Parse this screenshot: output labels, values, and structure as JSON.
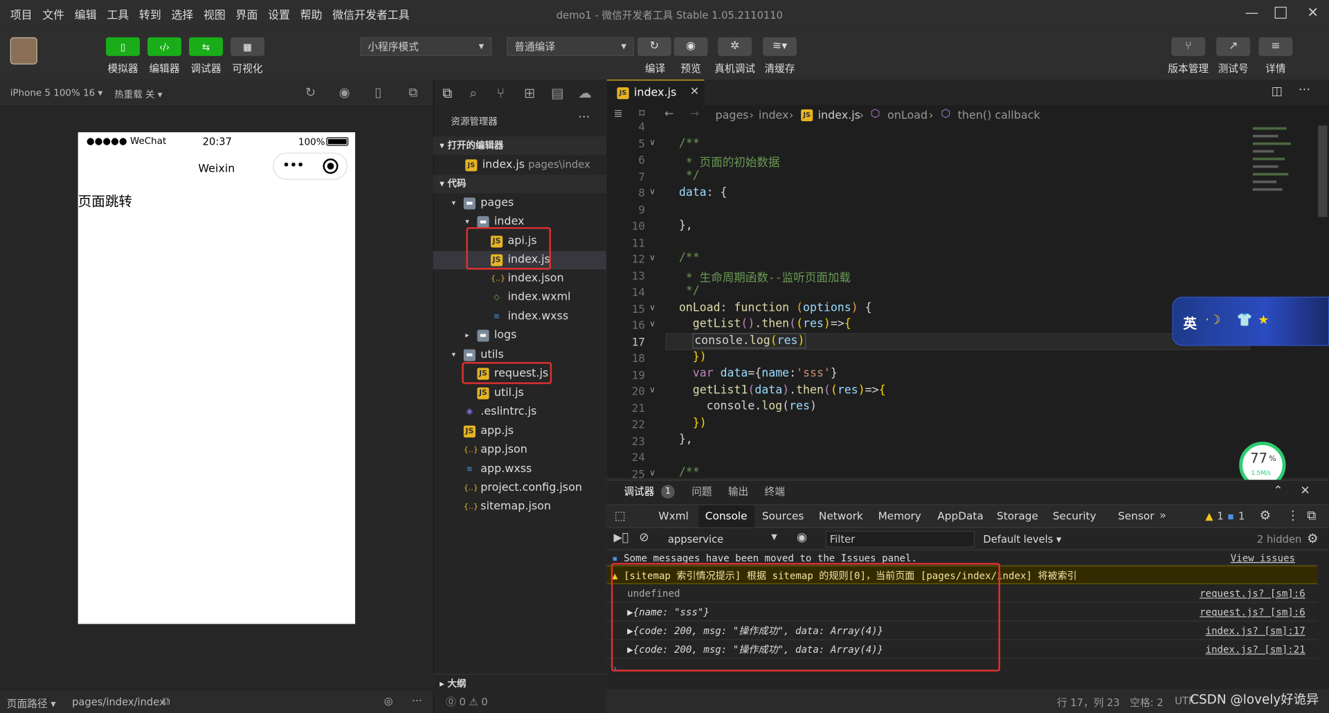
{
  "menu": [
    "项目",
    "文件",
    "编辑",
    "工具",
    "转到",
    "选择",
    "视图",
    "界面",
    "设置",
    "帮助",
    "微信开发者工具"
  ],
  "window_title": "demo1 - 微信开发者工具 Stable 1.05.2110110",
  "toolbar": {
    "simulator": "模拟器",
    "editor": "编辑器",
    "debugger": "调试器",
    "visualize": "可视化",
    "mode": "小程序模式",
    "compile_mode": "普通编译",
    "compile": "编译",
    "preview": "预览",
    "remote_debug": "真机调试",
    "clear_cache": "清缓存",
    "version": "版本管理",
    "test": "测试号",
    "details": "详情"
  },
  "sim": {
    "device": "iPhone 5 100% 16",
    "hot_reload": "热重载 关",
    "carrier": "●●●●● WeChat",
    "time": "20:37",
    "battery": "100%",
    "nav_title": "Weixin",
    "page_text": "页面跳转",
    "path_label": "页面路径",
    "path": "pages/index/index"
  },
  "explorer": {
    "title": "资源管理器",
    "open_editors": "打开的编辑器",
    "open_file": "index.js",
    "open_file_path": "pages\\index",
    "code": "代码",
    "outline": "大纲",
    "errors": "⓪ 0 ⚠ 0",
    "tree": [
      "pages",
      "index",
      "api.js",
      "index.js",
      "index.json",
      "index.wxml",
      "index.wxss",
      "logs",
      "utils",
      "request.js",
      "util.js",
      ".eslintrc.js",
      "app.js",
      "app.json",
      "app.wxss",
      "project.config.json",
      "sitemap.json"
    ]
  },
  "editor": {
    "tab": "index.js",
    "breadcrumb": [
      "pages",
      "index",
      "index.js",
      "onLoad",
      "then() callback"
    ],
    "line_numbers": [
      "4",
      "5",
      "6",
      "7",
      "8",
      "9",
      "10",
      "11",
      "12",
      "13",
      "14",
      "15",
      "16",
      "17",
      "18",
      "19",
      "20",
      "21",
      "22",
      "23",
      "24",
      "25"
    ]
  },
  "ime": "英",
  "perf": {
    "value": "77",
    "unit": "%",
    "speed": "1.5M/s"
  },
  "devtools": {
    "tabs": [
      "调试器",
      "问题",
      "输出",
      "终端"
    ],
    "badge": "1",
    "panels": [
      "Wxml",
      "Console",
      "Sources",
      "Network",
      "Memory",
      "AppData",
      "Storage",
      "Security",
      "Sensor"
    ],
    "context": "appservice",
    "filter": "Filter",
    "levels": "Default levels",
    "hidden": "2 hidden",
    "warn_count": "1",
    "info_count": "1",
    "issues_msg": "Some messages have been moved to the Issues panel.",
    "view_issues": "View issues",
    "sitemap": "[sitemap 索引情况提示] 根据 sitemap 的规则[0]，当前页面 [pages/index/index] 将被索引",
    "rows": [
      {
        "text": "undefined",
        "src": "request.js? [sm]:6"
      },
      {
        "text": "▶{name: \"sss\"}",
        "src": "request.js? [sm]:6"
      },
      {
        "text": "▶{code: 200, msg: \"操作成功\", data: Array(4)}",
        "src": "index.js? [sm]:17"
      },
      {
        "text": "▶{code: 200, msg: \"操作成功\", data: Array(4)}",
        "src": "index.js? [sm]:21"
      }
    ]
  },
  "status": {
    "pos": "行 17，列 23",
    "indent": "空格: 2",
    "enc": "UTF",
    "watermark": "CSDN @lovely好诡异"
  }
}
